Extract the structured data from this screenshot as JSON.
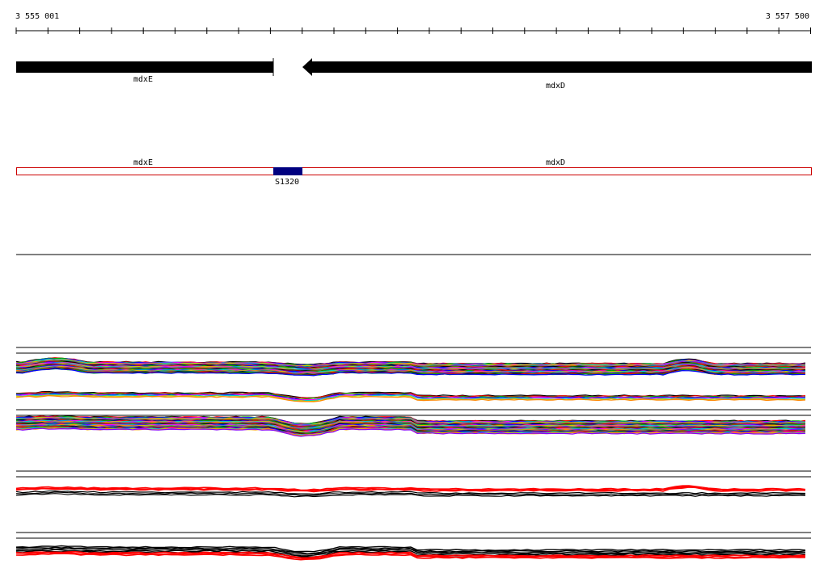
{
  "ruler": {
    "start_label": "3 555 001",
    "end_label": "3 557 500"
  },
  "genes": [
    {
      "name": "mdxE",
      "strand": "+",
      "color": "#000000"
    },
    {
      "name": "mdxD",
      "strand": "-",
      "color": "#000000"
    }
  ],
  "track_labels": {
    "gene_e": "mdxE",
    "gene_d": "mdxD",
    "feature": "S1320"
  },
  "feature": {
    "name": "S1320",
    "color": "#000080"
  },
  "annotation_box_color": "#cc0000",
  "expression_colors": [
    "#000000",
    "#ff0000",
    "#00aa00",
    "#0000ff",
    "#ff00ff",
    "#00cccc",
    "#cccc00",
    "#ff8800",
    "#8800ff",
    "#008888",
    "#888888",
    "#aa4400"
  ]
}
